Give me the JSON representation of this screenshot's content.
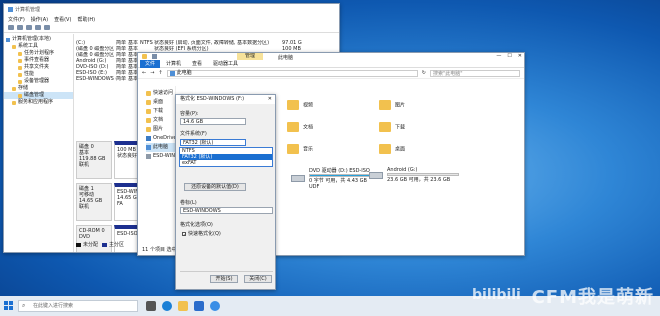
{
  "disk_mgmt": {
    "title": "计算机管理",
    "menu": [
      "文件(F)",
      "操作(A)",
      "查看(V)",
      "帮助(H)"
    ],
    "tree": [
      {
        "label": "计算机管理(本地)",
        "indent": 0
      },
      {
        "label": "系统工具",
        "indent": 1
      },
      {
        "label": "任务计划程序",
        "indent": 2
      },
      {
        "label": "事件查看器",
        "indent": 2
      },
      {
        "label": "共享文件夹",
        "indent": 2
      },
      {
        "label": "性能",
        "indent": 2
      },
      {
        "label": "设备管理器",
        "indent": 2
      },
      {
        "label": "存储",
        "indent": 1
      },
      {
        "label": "磁盘管理",
        "indent": 2,
        "selected": true
      },
      {
        "label": "服务和应用程序",
        "indent": 1
      }
    ],
    "volumes": [
      {
        "name": "(C:)",
        "layout": "简单",
        "type": "基本",
        "fs": "NTFS",
        "status": "状态良好 (启动, 页面文件, 故障转储, 基本数据分区)",
        "capacity": "97.01 G"
      },
      {
        "name": "(磁盘 0 磁盘分区 2)",
        "layout": "简单",
        "type": "基本",
        "fs": "",
        "status": "状态良好 (EFI 系统分区)",
        "capacity": "100 MB"
      },
      {
        "name": "(磁盘 0 磁盘分区 4)",
        "layout": "简单",
        "type": "基本",
        "fs": "",
        "status": "状态良好 (恢复分区)",
        "capacity": "540 MB"
      },
      {
        "name": "Android (G:)",
        "layout": "简单",
        "type": "基本",
        "fs": "",
        "status": "",
        "capacity": ""
      },
      {
        "name": "DVD-ISO (D:)",
        "layout": "简单",
        "type": "基本",
        "fs": "",
        "status": "",
        "capacity": ""
      },
      {
        "name": "ESD-ISO (E:)",
        "layout": "简单",
        "type": "基本",
        "fs": "",
        "status": "",
        "capacity": ""
      },
      {
        "name": "ESD-WINDOWS (F:)",
        "layout": "简单",
        "type": "基本",
        "fs": "",
        "status": "",
        "capacity": ""
      }
    ],
    "disks": [
      {
        "label": "磁盘 0",
        "type": "基本",
        "size": "119.88 GB",
        "state": "联机",
        "parts": [
          {
            "title": "100 MB",
            "sub": "状态良好"
          },
          {
            "title": "97.01 GB",
            "sub": "状态良好"
          }
        ]
      },
      {
        "label": "磁盘 1",
        "type": "可移动",
        "size": "14.65 GB",
        "state": "联机",
        "parts": [
          {
            "title": "ESD-WIND",
            "sub": "14.65 GB FA"
          },
          {
            "title": "",
            "sub": ""
          }
        ]
      },
      {
        "label": "CD-ROM 0",
        "type": "DVD",
        "size": "",
        "state": "",
        "parts": [
          {
            "title": "ESD-ISO",
            "sub": ""
          },
          {
            "title": "",
            "sub": ""
          }
        ]
      }
    ],
    "legend": [
      "未分配",
      "主分区"
    ],
    "legend_colors": [
      "#111111",
      "#1c2f8f"
    ]
  },
  "explorer": {
    "title": "此电脑",
    "manage_tab": "管理",
    "ribbon_tabs": [
      "文件",
      "计算机",
      "查看",
      "驱动器工具"
    ],
    "address": "此电脑",
    "search_placeholder": "搜索\"此电脑\"",
    "nav": [
      "快速访问",
      "桌面",
      "下载",
      "文档",
      "图片",
      "OneDrive",
      "此电脑",
      "ESD-WINI"
    ],
    "nav_selected": 6,
    "folders": [
      "视频",
      "图片",
      "文档",
      "下载",
      "音乐",
      "桌面"
    ],
    "drives": [
      {
        "name": "DVD 驱动器 (D:) ESD-ISO",
        "free": "0 字节 可用，共 4.43 GB",
        "sub": "UDF",
        "used": 1.0
      },
      {
        "name": "",
        "free": "",
        "sub": "",
        "used": 0.6
      },
      {
        "name": "Android (G:)",
        "free": "23.6 GB 可用，共 23.6 GB",
        "sub": "",
        "used": 0.0
      }
    ],
    "status": "11 个项目   选中 1 个项目"
  },
  "format_dialog": {
    "title": "格式化 ESD-WINDOWS (F:)",
    "capacity_label": "容量(P):",
    "capacity_value": "14.6 GB",
    "fs_label": "文件系统(F)",
    "fs_value": "FAT32 (默认)",
    "fs_options": [
      "NTFS",
      "FAT32 (默认)",
      "exFAT"
    ],
    "fs_selected": 1,
    "restore_btn": "还原设备的默认值(D)",
    "volume_label": "卷标(L)",
    "volume_value": "ESD-WINDOWS",
    "format_options_label": "格式化选项(O)",
    "quick_format": "快速格式化(Q)",
    "start_btn": "开始(S)",
    "close_btn": "关闭(C)"
  },
  "taskbar": {
    "search_placeholder": "在此键入进行搜索",
    "accent": "#1a6fd1"
  },
  "watermark": {
    "brand": "bilibili",
    "text": "CFM我是萌新"
  }
}
